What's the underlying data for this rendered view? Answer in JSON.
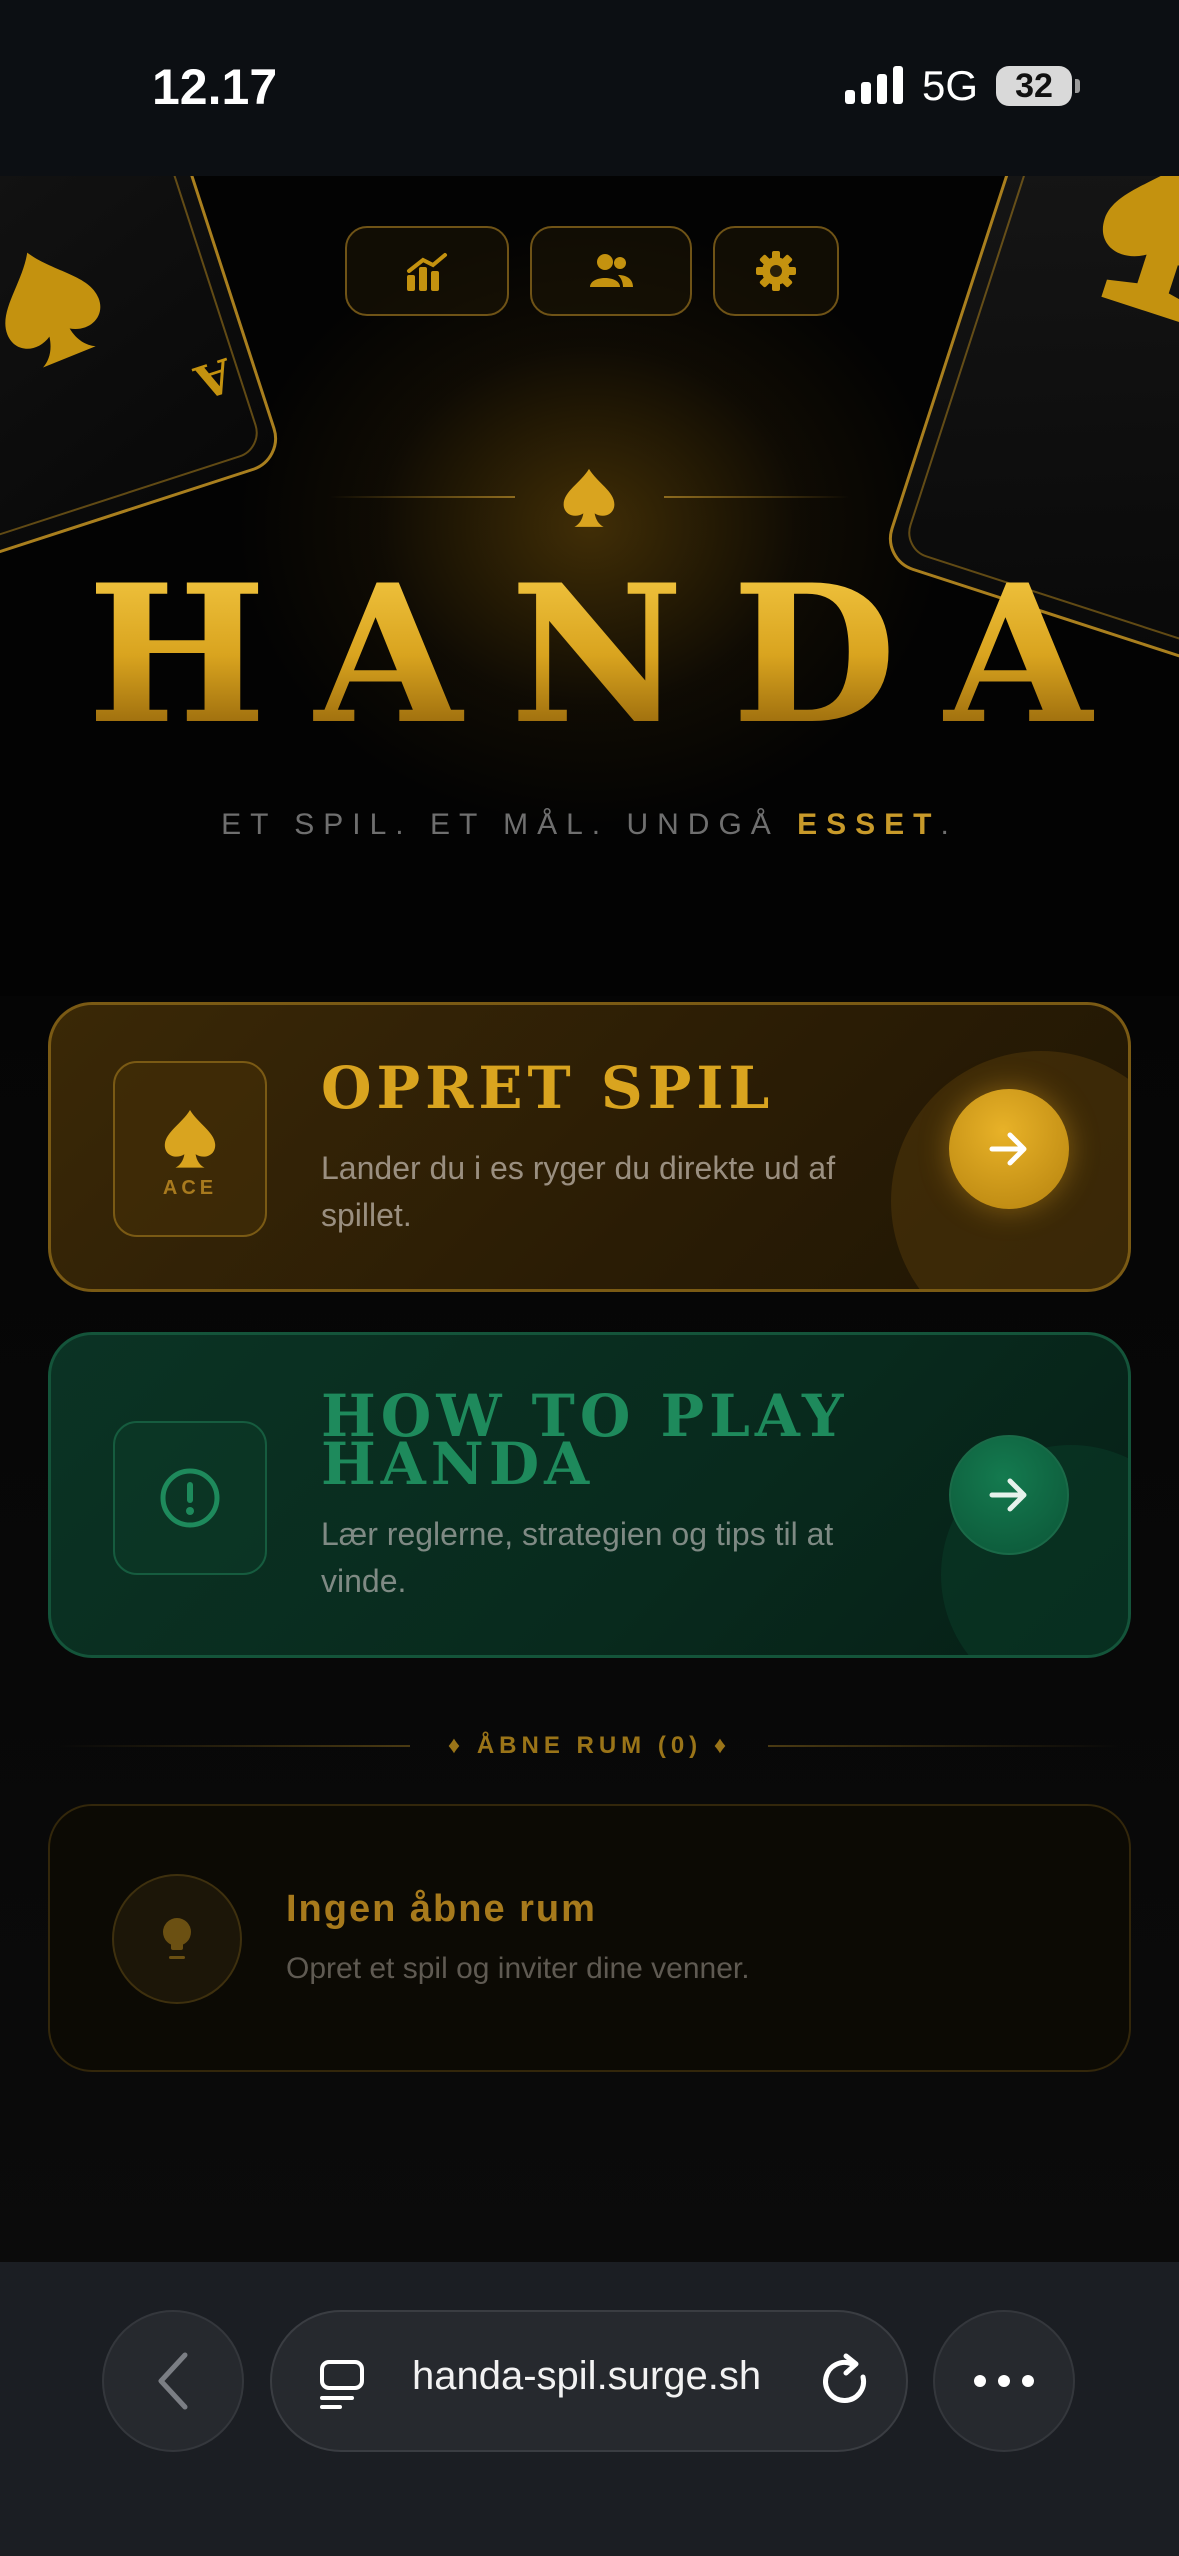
{
  "status_bar": {
    "time": "12.17",
    "network": "5G",
    "battery": "32"
  },
  "hero": {
    "title": "HANDA",
    "subtitle_prefix": "ET SPIL. ET MÅL. UNDGÅ",
    "subtitle_highlight": "ESSET",
    "subtitle_suffix": ".",
    "card_rank": "A",
    "top_buttons": [
      {
        "icon": "stats-icon"
      },
      {
        "icon": "users-icon"
      },
      {
        "icon": "gear-icon"
      }
    ]
  },
  "create_card": {
    "badge": "ACE",
    "title": "OPRET SPIL",
    "description": "Lander du i es ryger du direkte ud af spillet."
  },
  "howto_card": {
    "title_line1": "HOW TO PLAY",
    "title_line2": "HANDA",
    "description": "Lær reglerne, strategien og tips til at vinde."
  },
  "rooms": {
    "label": "♦ ÅBNE RUM (0) ♦",
    "empty_title": "Ingen åbne rum",
    "empty_subtitle": "Opret et spil og inviter dine venner."
  },
  "browser": {
    "url": "handa-spil.surge.sh"
  },
  "colors": {
    "gold": "#d9a41f",
    "green": "#1e8a5c",
    "background": "#000000"
  }
}
